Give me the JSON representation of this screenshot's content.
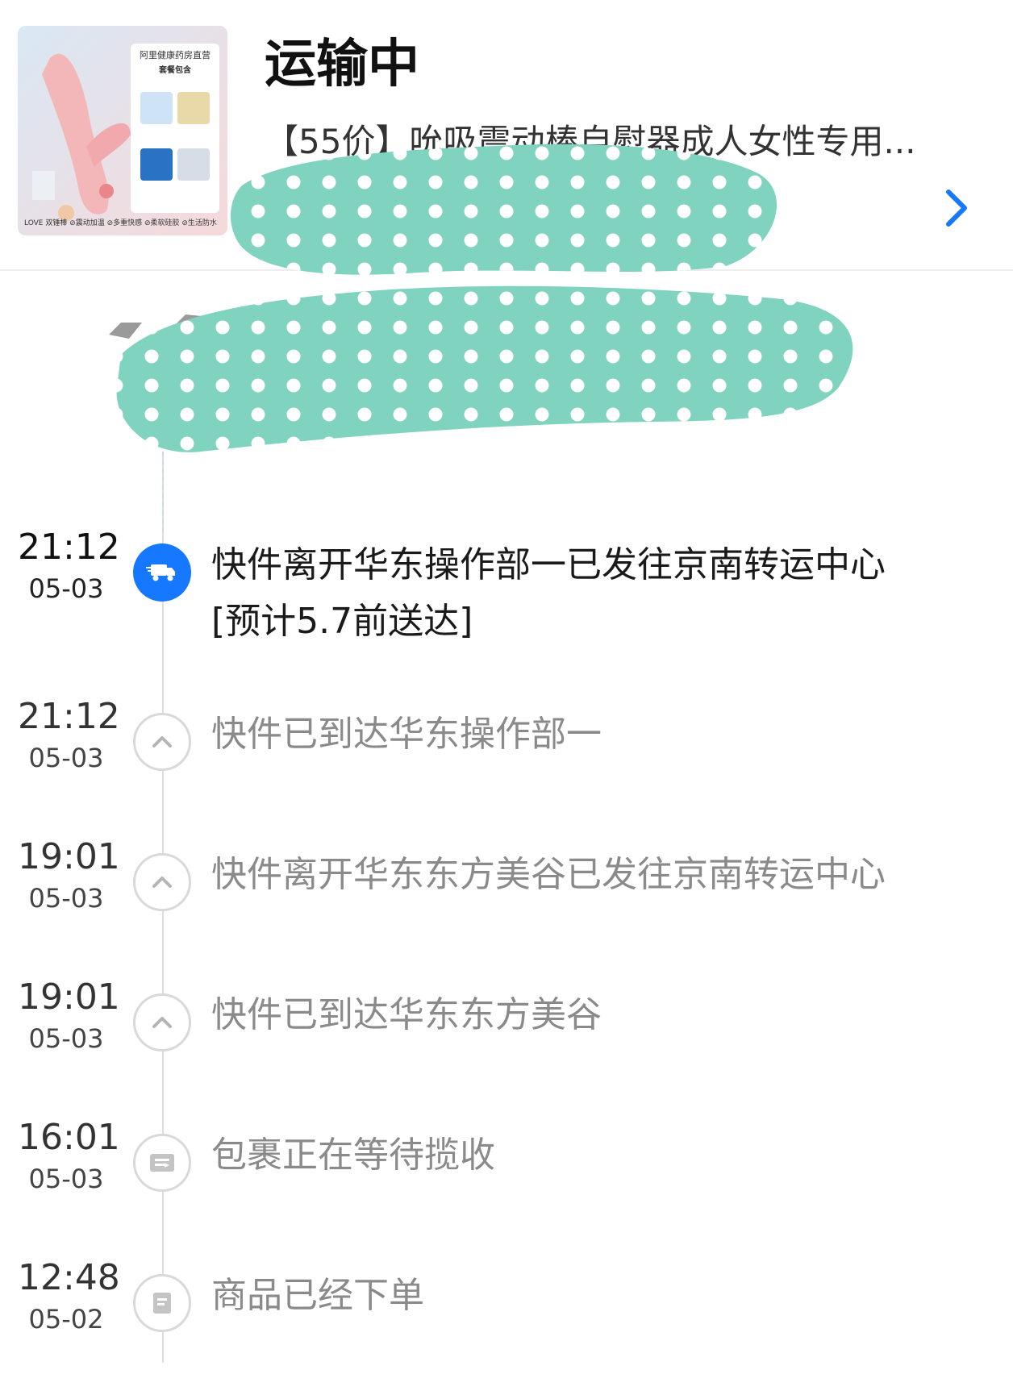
{
  "header": {
    "status": "运输中",
    "product_name": "【55价】吮吸震动棒自慰器成人女性专用...",
    "thumbnail": {
      "panel_title": "阿里健康药房直营",
      "panel_subtitle": "套餐包含",
      "caption": "LOVE 双锤棒  ⊘震动加温 ⊘多重快感 ⊘柔软硅胶 ⊘生活防水"
    }
  },
  "timeline": [
    {
      "time": "21:12",
      "date": "05-03",
      "text": "快件离开华东操作部一已发往京南转运中心",
      "subtext": "[预计5.7前送达]",
      "icon": "truck-icon",
      "current": true
    },
    {
      "time": "21:12",
      "date": "05-03",
      "text": "快件已到达华东操作部一",
      "icon": "caret-up-icon",
      "current": false
    },
    {
      "time": "19:01",
      "date": "05-03",
      "text": "快件离开华东东方美谷已发往京南转运中心",
      "icon": "caret-up-icon",
      "current": false
    },
    {
      "time": "19:01",
      "date": "05-03",
      "text": "快件已到达华东东方美谷",
      "icon": "caret-up-icon",
      "current": false
    },
    {
      "time": "16:01",
      "date": "05-03",
      "text": "包裹正在等待揽收",
      "icon": "package-pickup-icon",
      "current": false
    },
    {
      "time": "12:48",
      "date": "05-02",
      "text": "商品已经下单",
      "icon": "order-document-icon",
      "current": false
    }
  ],
  "colors": {
    "accent": "#1677ff",
    "redaction": "#7fd3bf",
    "muted_text": "#8a8a8a"
  }
}
